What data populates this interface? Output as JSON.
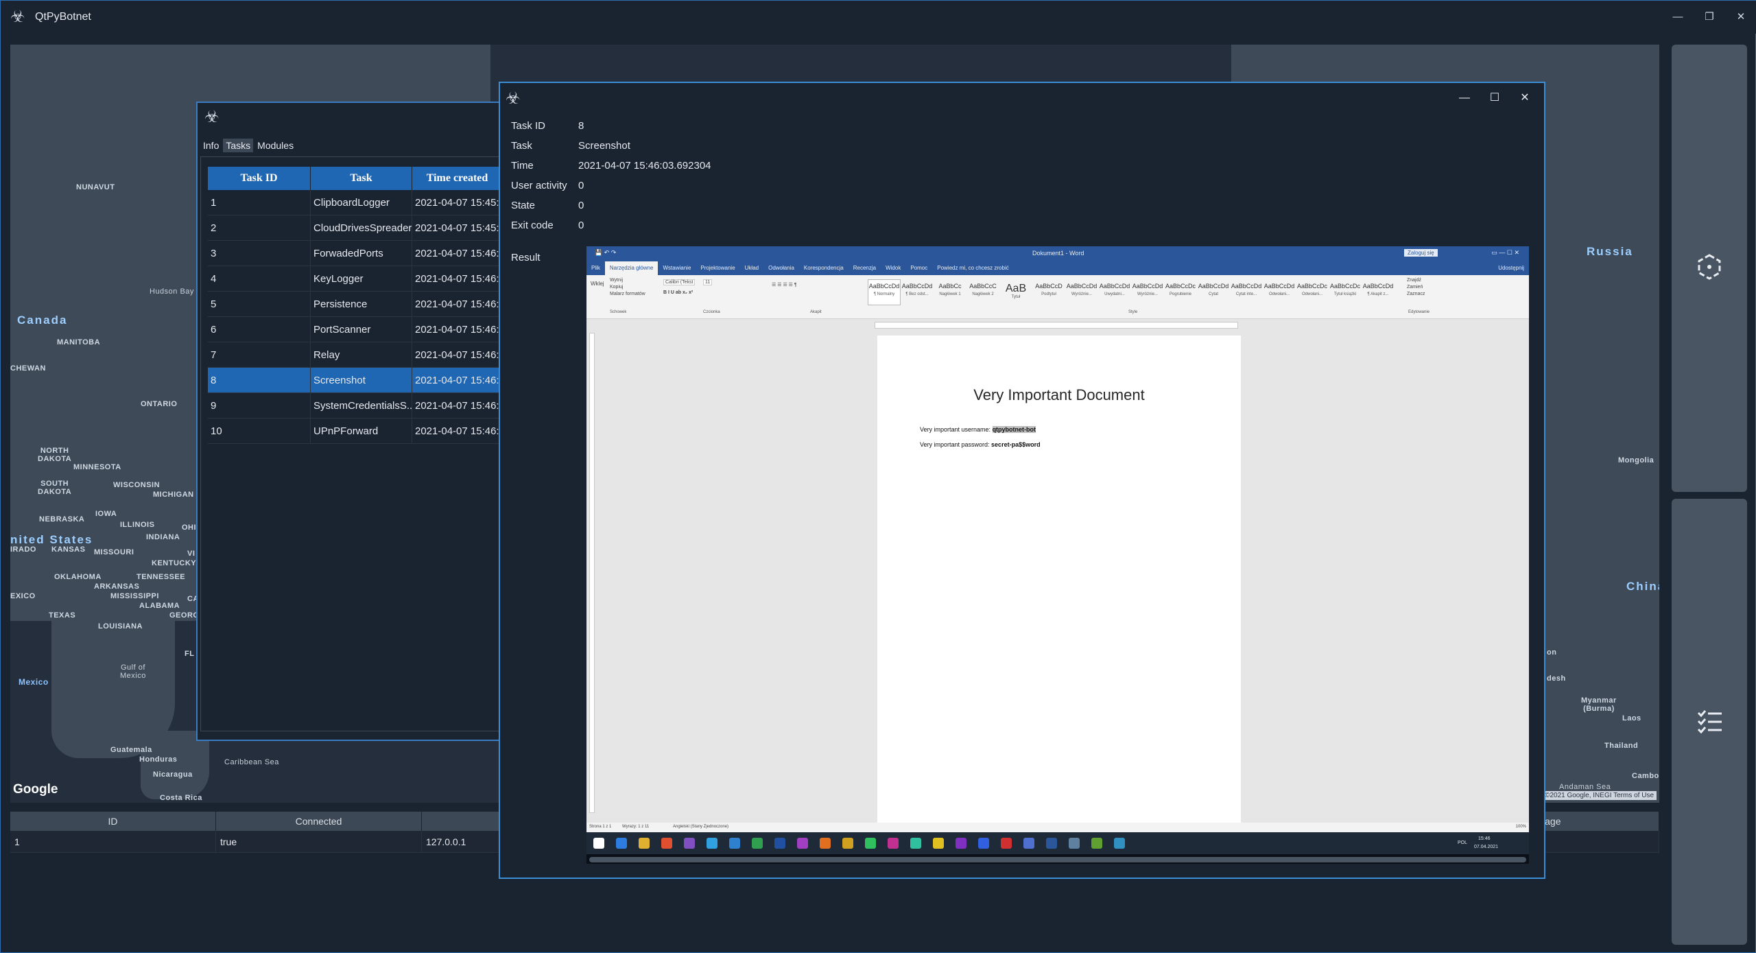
{
  "app": {
    "title": "QtPyBotnet",
    "icon": "biohazard-icon",
    "controls": [
      "—",
      "❐",
      "✕"
    ]
  },
  "map": {
    "google_logo": "Google",
    "attribution": "©2021 Google, INEGI  Terms of Use",
    "labels": {
      "nunavut": "NUNAVUT",
      "hudson_bay": "Hudson Bay",
      "canada": "Canada",
      "manitoba": "MANITOBA",
      "chewan": "CHEWAN",
      "ontario": "ONTARIO",
      "north_dakota": "NORTH\nDAKOTA",
      "minnesota": "MINNESOTA",
      "south_dakota": "SOUTH\nDAKOTA",
      "wisconsin": "WISCONSIN",
      "michigan": "MICHIGAN",
      "nebraska": "NEBRASKA",
      "iowa": "IOWA",
      "illinois": "ILLINOIS",
      "ohio": "OHI",
      "united_states": "nited States",
      "kansas": "KANSAS",
      "missouri": "MISSOURI",
      "indiana": "INDIANA",
      "irado": "IRADO",
      "kentucky": "KENTUCKY",
      "vi": "VI",
      "oklahoma": "OKLAHOMA",
      "tennessee": "TENNESSEE",
      "arkansas": "ARKANSAS",
      "exico": "EXICO",
      "mississippi": "MISSISSIPPI",
      "alabama": "ALABAMA",
      "ca": "CA",
      "georg": "GEORG",
      "texas": "TEXAS",
      "louisiana": "LOUISIANA",
      "fl": "FL",
      "gulf_of_mexico": "Gulf of\nMexico",
      "mexico": "Mexico",
      "guatemala": "Guatemala",
      "honduras": "Honduras",
      "nicaragua": "Nicaragua",
      "costa_rica": "Costa Rica",
      "caribbean_sea": "Caribbean Sea",
      "russia": "Russia",
      "mongolia": "Mongolia",
      "china": "China",
      "desh": "desh",
      "myanmar": "Myanmar\n(Burma)",
      "laos": "Laos",
      "thailand": "Thailand",
      "cambo": "Cambo",
      "andaman_sea": "Andaman Sea",
      "on": "on"
    }
  },
  "right_panel": {
    "top_icon": "hexagon-nodes-icon",
    "bottom_icon": "checklist-icon"
  },
  "clients": {
    "columns": [
      "ID",
      "Connected",
      "",
      "anguage"
    ],
    "rows": [
      [
        "1",
        "true",
        "127.0.0.1",
        ""
      ]
    ]
  },
  "tasks_window": {
    "icon": "biohazard-icon",
    "tabs": [
      "Info",
      "Tasks",
      "Modules"
    ],
    "active_tab": "Tasks",
    "columns": [
      "Task ID",
      "Task",
      "Time created"
    ],
    "rows": [
      [
        "1",
        "ClipboardLogger",
        "2021-04-07 15:45:"
      ],
      [
        "2",
        "CloudDrivesSpreader",
        "2021-04-07 15:45:"
      ],
      [
        "3",
        "ForwadedPorts",
        "2021-04-07 15:46:"
      ],
      [
        "4",
        "KeyLogger",
        "2021-04-07 15:46:"
      ],
      [
        "5",
        "Persistence",
        "2021-04-07 15:46:"
      ],
      [
        "6",
        "PortScanner",
        "2021-04-07 15:46:"
      ],
      [
        "7",
        "Relay",
        "2021-04-07 15:46:"
      ],
      [
        "8",
        "Screenshot",
        "2021-04-07 15:46:"
      ],
      [
        "9",
        "SystemCredentialsS...",
        "2021-04-07 15:46:"
      ],
      [
        "10",
        "UPnPForward",
        "2021-04-07 15:46:"
      ]
    ],
    "selected_row": 8
  },
  "detail_window": {
    "icon": "biohazard-icon",
    "controls": [
      "—",
      "☐",
      "✕"
    ],
    "fields": [
      {
        "key": "Task ID",
        "value": "8"
      },
      {
        "key": "Task",
        "value": "Screenshot"
      },
      {
        "key": "Time",
        "value": "2021-04-07 15:46:03.692304"
      },
      {
        "key": "User activity",
        "value": "0"
      },
      {
        "key": "State",
        "value": "0"
      },
      {
        "key": "Exit code",
        "value": "0"
      }
    ],
    "result_label": "Result"
  },
  "screenshot": {
    "word_title": "Dokument1 - Word",
    "sign_in": "Zaloguj się",
    "tabs": [
      "Plik",
      "Narzędzia główne",
      "Wstawianie",
      "Projektowanie",
      "Układ",
      "Odwołania",
      "Korespondencja",
      "Recenzja",
      "Widok",
      "Pomoc",
      "Powiedz mi, co chcesz zrobić"
    ],
    "share": "Udostępnij",
    "clipboard": [
      "Wklej",
      "Wytnij",
      "Kopiuj",
      "Malarz formatów"
    ],
    "font": "Calibri (Tekst",
    "font_size": "11",
    "styles": [
      {
        "sample": "AaBbCcDd",
        "name": "¶ Normalny"
      },
      {
        "sample": "AaBbCcDd",
        "name": "¶ Bez odst..."
      },
      {
        "sample": "AaBbCc",
        "name": "Nagłówek 1"
      },
      {
        "sample": "AaBbCcC",
        "name": "Nagłówek 2"
      },
      {
        "sample": "AaB",
        "name": "Tytuł"
      },
      {
        "sample": "AaBbCcD",
        "name": "Podtytuł"
      },
      {
        "sample": "AaBbCcDd",
        "name": "Wyróżnie..."
      },
      {
        "sample": "AaBbCcDd",
        "name": "Uwydatni..."
      },
      {
        "sample": "AaBbCcDd",
        "name": "Wyróżnie..."
      },
      {
        "sample": "AaBbCcDc",
        "name": "Pogrubienie"
      },
      {
        "sample": "AaBbCcDd",
        "name": "Cytat"
      },
      {
        "sample": "AaBbCcDd",
        "name": "Cytat inte..."
      },
      {
        "sample": "AaBbCcDd",
        "name": "Odwołani..."
      },
      {
        "sample": "AaBbCcDc",
        "name": "Odwołani..."
      },
      {
        "sample": "AaBbCcDc",
        "name": "Tytuł książki"
      },
      {
        "sample": "AaBbCcDd",
        "name": "¶ Akapit z..."
      }
    ],
    "editing": [
      "Znajdź",
      "Zamień",
      "Zaznacz"
    ],
    "group_names": [
      "Schowek",
      "Czcionka",
      "Akapit",
      "Style",
      "Edytowanie"
    ],
    "doc_title": "Very Important Document",
    "username_label": "Very important username: ",
    "username_value": "qtpybotnet-bot",
    "password_label": "Very important password: ",
    "password_value": "secret-pa$$word",
    "status_page": "Strona 1 z 1",
    "status_words": "Wyrazy: 1 z 11",
    "status_lang": "Angielski (Stany Zjednoczone)",
    "zoom": "100%",
    "tray_lang": "POL",
    "tray_time": "15:46",
    "tray_date": "07.04.2021"
  }
}
